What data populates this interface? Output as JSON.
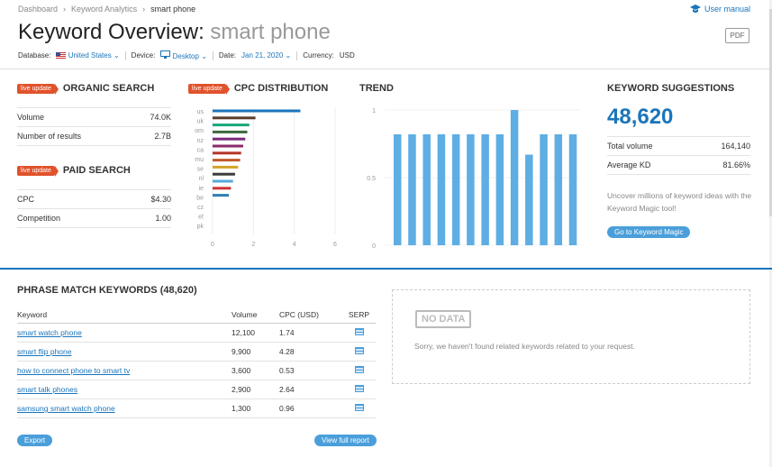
{
  "breadcrumb": [
    "Dashboard",
    "Keyword Analytics",
    "smart phone"
  ],
  "user_manual": "User manual",
  "title": {
    "prefix": "Keyword Overview:",
    "query": "smart phone"
  },
  "pdf_label": "PDF",
  "filters": {
    "database_label": "Database:",
    "database_value": "United States",
    "device_label": "Device:",
    "device_value": "Desktop",
    "date_label": "Date:",
    "date_value": "Jan 21, 2020",
    "currency_label": "Currency:",
    "currency_value": "USD"
  },
  "badge_label": "live update",
  "organic": {
    "heading": "ORGANIC SEARCH",
    "rows": [
      {
        "label": "Volume",
        "value": "74.0K"
      },
      {
        "label": "Number of results",
        "value": "2.7B"
      }
    ]
  },
  "paid": {
    "heading": "PAID SEARCH",
    "rows": [
      {
        "label": "CPC",
        "value": "$4.30"
      },
      {
        "label": "Competition",
        "value": "1.00"
      }
    ]
  },
  "cpc": {
    "heading": "CPC DISTRIBUTION",
    "chart_data": {
      "type": "bar",
      "orientation": "horizontal",
      "categories": [
        "us",
        "uk",
        "om",
        "nz",
        "ca",
        "mu",
        "se",
        "nl",
        "ie",
        "be",
        "cz",
        "et",
        "pk"
      ],
      "values": [
        4.3,
        2.1,
        1.8,
        1.7,
        1.6,
        1.5,
        1.4,
        1.35,
        1.25,
        1.1,
        1.0,
        0.9,
        0.8
      ],
      "bar_colors": [
        "#1a75bb",
        "#5a3e2b",
        "#1aa67c",
        "#3e6a3e",
        "#7a2a7a",
        "#8a2a6a",
        "#b5342a",
        "#c05a2a",
        "#d4a32a",
        "#3a3a3a",
        "#55aadd",
        "#cc3333",
        "#2f7fb0",
        "#999999",
        "#2e8b57",
        "#d87a2a",
        "#6a5acd",
        "#c0aa33",
        "#7777aa",
        "#333366",
        "#dd9933",
        "#55bb55"
      ],
      "xticks": [
        "0",
        "2",
        "4",
        "6"
      ],
      "xlim": [
        0,
        6
      ],
      "grid": true
    }
  },
  "trend": {
    "heading": "TREND",
    "chart_data": {
      "type": "bar",
      "values": [
        0.82,
        0.82,
        0.82,
        0.82,
        0.82,
        0.82,
        0.82,
        0.82,
        1.0,
        0.67,
        0.82,
        0.82,
        0.82
      ],
      "yticks": [
        "1",
        "0.5",
        "0"
      ],
      "ylim": [
        0,
        1
      ],
      "color": "#5eaee3"
    }
  },
  "suggestions": {
    "heading": "KEYWORD SUGGESTIONS",
    "count": "48,620",
    "rows": [
      {
        "label": "Total volume",
        "value": "164,140"
      },
      {
        "label": "Average KD",
        "value": "81.66%"
      }
    ],
    "text": "Uncover millions of keyword ideas with the Keyword Magic tool!",
    "button": "Go to Keyword Magic"
  },
  "phrase": {
    "heading": "PHRASE MATCH KEYWORDS (48,620)",
    "columns": [
      "Keyword",
      "Volume",
      "CPC (USD)",
      "SERP"
    ],
    "rows": [
      {
        "keyword": "smart watch phone",
        "volume": "12,100",
        "cpc": "1.74"
      },
      {
        "keyword": "smart flip phone",
        "volume": "9,900",
        "cpc": "4.28"
      },
      {
        "keyword": "how to connect phone to smart tv",
        "volume": "3,600",
        "cpc": "0.53"
      },
      {
        "keyword": "smart talk phones",
        "volume": "2,900",
        "cpc": "2.64"
      },
      {
        "keyword": "samsung smart watch phone",
        "volume": "1,300",
        "cpc": "0.96"
      }
    ],
    "export": "Export",
    "view_full": "View full report"
  },
  "nodata": {
    "badge": "NO DATA",
    "text": "Sorry, we haven't found related keywords related to your request."
  }
}
